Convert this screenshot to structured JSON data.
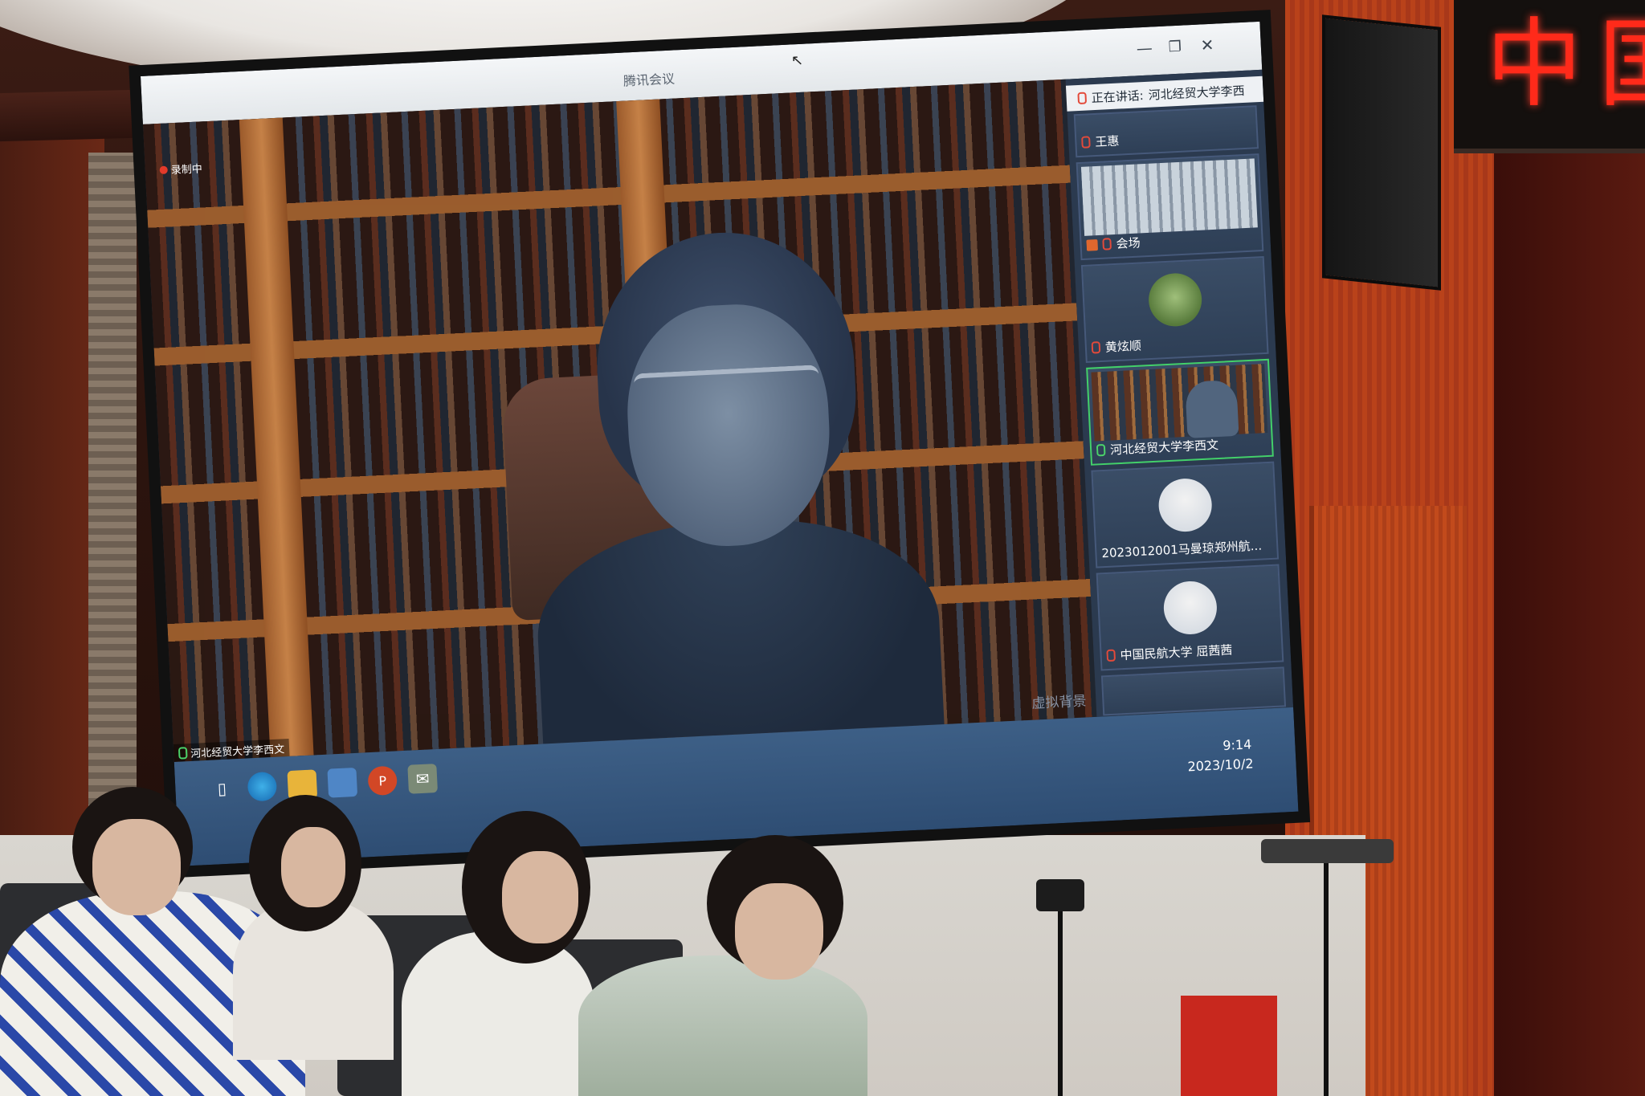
{
  "window": {
    "title": "腾讯会议",
    "minimize_glyph": "—",
    "maximize_glyph": "❐",
    "close_glyph": "✕"
  },
  "main_video": {
    "recording_label": "录制中",
    "virtual_bg_label": "虚拟背景",
    "speaker_name": "河北经贸大学李西文"
  },
  "panel": {
    "speaking_label": "正在讲话:",
    "speaking_name": "河北经贸大学李西",
    "participants": [
      {
        "name": "王惠",
        "mic": "muted"
      },
      {
        "name": "会场",
        "mic": "muted"
      },
      {
        "name": "黄炫顺",
        "mic": "muted"
      },
      {
        "name": "河北经贸大学李西文",
        "mic": "active"
      },
      {
        "name": "2023012001马曼琼郑州航...",
        "mic": "none"
      },
      {
        "name": "中国民航大学 屈茜茜",
        "mic": "muted"
      }
    ]
  },
  "taskbar": {
    "time": "9:14",
    "date": "2023/10/2",
    "icons": [
      "task-view-icon",
      "edge-icon",
      "file-explorer-icon",
      "meeting-icon",
      "powerpoint-icon",
      "wechat-icon"
    ]
  },
  "room": {
    "led_sign": "中国"
  },
  "colors": {
    "active_speaker_border": "#43d06a",
    "muted_mic": "#e34a3a",
    "led_red": "#ff2a1a"
  }
}
